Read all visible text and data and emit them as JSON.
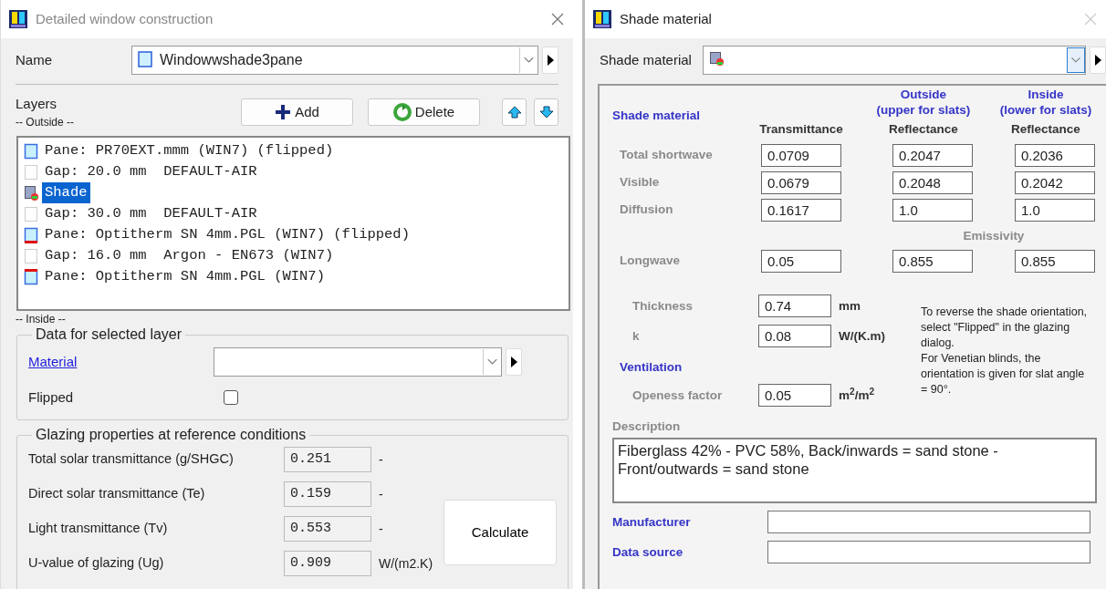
{
  "construction_window": {
    "title": "Detailed window construction",
    "name_label": "Name",
    "name_value": "Windowwshade3pane",
    "layers_label": "Layers",
    "outside_label": "-- Outside --",
    "add_button": "Add",
    "delete_button": "Delete",
    "layers": [
      {
        "kind": "pane",
        "text": "Pane: PR70EXT.mmm (WIN7) (flipped)",
        "coated_top": false,
        "coated_bottom": false,
        "selected": false
      },
      {
        "kind": "gap",
        "text": "Gap: 20.0 mm  DEFAULT-AIR",
        "selected": false
      },
      {
        "kind": "shade",
        "text": "Shade",
        "selected": true
      },
      {
        "kind": "gap",
        "text": "Gap: 30.0 mm  DEFAULT-AIR",
        "selected": false
      },
      {
        "kind": "pane",
        "text": "Pane: Optitherm SN 4mm.PGL (WIN7) (flipped)",
        "coated_top": false,
        "coated_bottom": true,
        "selected": false
      },
      {
        "kind": "gap",
        "text": "Gap: 16.0 mm  Argon - EN673 (WIN7)",
        "selected": false
      },
      {
        "kind": "pane",
        "text": "Pane: Optitherm SN 4mm.PGL (WIN7)",
        "coated_top": true,
        "coated_bottom": false,
        "selected": false
      }
    ],
    "inside_label": "-- Inside --",
    "layer_data": {
      "title": "Data for selected layer",
      "material_label": "Material",
      "flipped_label": "Flipped",
      "flipped": false
    },
    "glazing": {
      "title": "Glazing properties at reference conditions",
      "rows": [
        {
          "label": "Total solar transmittance (g/SHGC)",
          "value": "0.251",
          "unit": "-"
        },
        {
          "label": "Direct solar transmittance (Te)",
          "value": "0.159",
          "unit": "-"
        },
        {
          "label": "Light transmittance (Tv)",
          "value": "0.553",
          "unit": "-"
        },
        {
          "label": "U-value of glazing (Ug)",
          "value": "0.909",
          "unit": "W/(m2.K)"
        }
      ],
      "calculate_button": "Calculate"
    }
  },
  "shade_window": {
    "title": "Shade material",
    "selector_label": "Shade material",
    "heading": "Shade material",
    "columns": [
      {
        "header": "Transmittance"
      },
      {
        "group": "Outside",
        "subgroup": "(upper for slats)",
        "header": "Reflectance"
      },
      {
        "group": "Inside",
        "subgroup": "(lower for slats)",
        "header": "Reflectance"
      }
    ],
    "rows": [
      {
        "label": "Total shortwave",
        "values": [
          "0.0709",
          "0.2047",
          "0.2036"
        ]
      },
      {
        "label": "Visible",
        "values": [
          "0.0679",
          "0.2048",
          "0.2042"
        ]
      },
      {
        "label": "Diffusion",
        "values": [
          "0.1617",
          "1.0",
          "1.0"
        ]
      }
    ],
    "emissivity_label": "Emissivity",
    "longwave": {
      "label": "Longwave",
      "values": [
        "0.05",
        "0.855",
        "0.855"
      ]
    },
    "properties": [
      {
        "label": "Thickness",
        "value": "0.74",
        "unit": "mm"
      },
      {
        "label": "k",
        "value": "0.08",
        "unit": "W/(K.m)"
      }
    ],
    "ventilation_label": "Ventilation",
    "openness": {
      "label": "Openess factor",
      "value": "0.05",
      "unit": "m$^{2}$/m$^{2}$"
    },
    "notes": [
      "To reverse the shade orientation, select \"Flipped\" in the glazing dialog.",
      "For Venetian blinds, the orientation is given for slat angle = 90°."
    ],
    "description_label": "Description",
    "description": "Fiberglass 42% - PVC 58%, Back/inwards = sand stone - Front/outwards = sand stone",
    "manufacturer_label": "Manufacturer",
    "data_source_label": "Data source"
  }
}
